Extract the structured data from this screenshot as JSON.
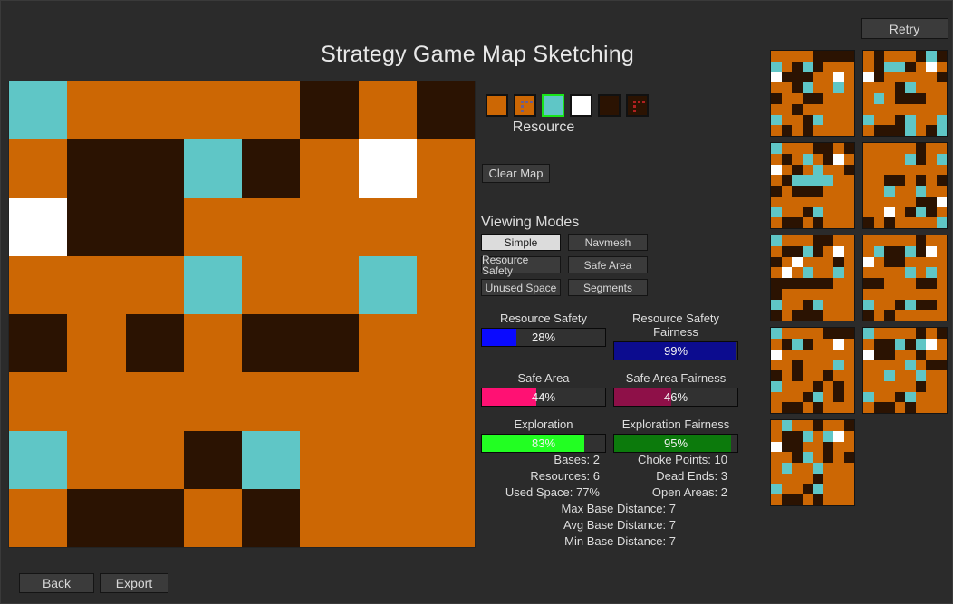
{
  "app": {
    "title": "Strategy Game Map Sketching",
    "background_color": "#2b2b2b"
  },
  "top_bar": {
    "retry_label": "Retry"
  },
  "colors": {
    "ground": "#cc6704",
    "wall": "#2b1302",
    "resource": "#5fc6c6",
    "base": "#ffffff",
    "accent_selected": "#19e519"
  },
  "palette": {
    "label": "Resource",
    "selected_index": 2,
    "swatches": [
      {
        "name": "ground",
        "fill": "#cc6704",
        "mark": null
      },
      {
        "name": "ground-ramp",
        "fill": "#cc6704",
        "mark": "#6a5f8e"
      },
      {
        "name": "resource",
        "fill": "#5fc6c6",
        "mark": null
      },
      {
        "name": "base",
        "fill": "#ffffff",
        "mark": null
      },
      {
        "name": "wall",
        "fill": "#2b1302",
        "mark": null
      },
      {
        "name": "wall-ramp",
        "fill": "#2b1302",
        "mark": "#b02020"
      }
    ]
  },
  "tools": {
    "clear_map_label": "Clear Map"
  },
  "viewing_modes": {
    "title": "Viewing Modes",
    "active": "Simple",
    "items": [
      {
        "label": "Simple",
        "active": true
      },
      {
        "label": "Navmesh",
        "active": false
      },
      {
        "label": "Resource Safety",
        "active": false
      },
      {
        "label": "Safe Area",
        "active": false
      },
      {
        "label": "Unused Space",
        "active": false
      },
      {
        "label": "Segments",
        "active": false
      }
    ]
  },
  "metrics": [
    {
      "label": "Resource Safety",
      "value": 28,
      "text": "28%",
      "fill": "#0a0aff"
    },
    {
      "label": "Resource Safety Fairness",
      "value": 99,
      "text": "99%",
      "fill": "#0c0c8f"
    },
    {
      "label": "Safe Area",
      "value": 44,
      "text": "44%",
      "fill": "#ff1173"
    },
    {
      "label": "Safe Area Fairness",
      "value": 46,
      "text": "46%",
      "fill": "#8e1048"
    },
    {
      "label": "Exploration",
      "value": 83,
      "text": "83%",
      "fill": "#22ff22"
    },
    {
      "label": "Exploration Fairness",
      "value": 95,
      "text": "95%",
      "fill": "#0c7a0c"
    }
  ],
  "stats": {
    "left": [
      "Bases: 2",
      "Resources: 6",
      "Used Space: 77%"
    ],
    "right": [
      "Choke Points: 10",
      "Dead Ends: 3",
      "Open Areas: 2"
    ],
    "center": [
      "Max Base Distance: 7",
      "Avg Base Distance: 7",
      "Min Base Distance: 7"
    ]
  },
  "map": {
    "rows": 8,
    "cols": 8,
    "legend": {
      "g": "#cc6704",
      "w": "#2b1302",
      "r": "#5fc6c6",
      "b": "#ffffff"
    },
    "grid": [
      [
        "r",
        "g",
        "g",
        "g",
        "g",
        "w",
        "g",
        "w"
      ],
      [
        "g",
        "w",
        "w",
        "r",
        "w",
        "g",
        "b",
        "g"
      ],
      [
        "b",
        "w",
        "w",
        "g",
        "g",
        "g",
        "g",
        "g"
      ],
      [
        "g",
        "g",
        "g",
        "r",
        "g",
        "g",
        "r",
        "g"
      ],
      [
        "w",
        "g",
        "w",
        "g",
        "w",
        "w",
        "g",
        "g"
      ],
      [
        "g",
        "g",
        "g",
        "g",
        "g",
        "g",
        "g",
        "g"
      ],
      [
        "r",
        "g",
        "g",
        "w",
        "r",
        "g",
        "g",
        "g"
      ],
      [
        "g",
        "w",
        "w",
        "g",
        "w",
        "g",
        "g",
        "g"
      ]
    ]
  },
  "thumbnails": [
    {
      "name": "variant-1",
      "grid": [
        [
          "g",
          "g",
          "g",
          "g",
          "w",
          "w",
          "w",
          "w"
        ],
        [
          "r",
          "g",
          "w",
          "r",
          "w",
          "g",
          "g",
          "g"
        ],
        [
          "b",
          "w",
          "w",
          "w",
          "g",
          "g",
          "b",
          "g"
        ],
        [
          "g",
          "g",
          "w",
          "r",
          "g",
          "g",
          "r",
          "g"
        ],
        [
          "w",
          "g",
          "g",
          "w",
          "w",
          "g",
          "g",
          "g"
        ],
        [
          "g",
          "g",
          "w",
          "g",
          "g",
          "g",
          "g",
          "g"
        ],
        [
          "r",
          "g",
          "g",
          "w",
          "r",
          "g",
          "g",
          "g"
        ],
        [
          "g",
          "w",
          "g",
          "w",
          "g",
          "g",
          "g",
          "g"
        ]
      ]
    },
    {
      "name": "variant-2",
      "grid": [
        [
          "g",
          "w",
          "g",
          "g",
          "g",
          "w",
          "r",
          "w"
        ],
        [
          "g",
          "w",
          "r",
          "r",
          "w",
          "g",
          "b",
          "g"
        ],
        [
          "b",
          "w",
          "g",
          "g",
          "g",
          "g",
          "g",
          "w"
        ],
        [
          "g",
          "g",
          "g",
          "w",
          "r",
          "g",
          "g",
          "g"
        ],
        [
          "g",
          "r",
          "g",
          "w",
          "w",
          "w",
          "g",
          "g"
        ],
        [
          "g",
          "g",
          "g",
          "g",
          "g",
          "g",
          "g",
          "g"
        ],
        [
          "r",
          "g",
          "g",
          "w",
          "r",
          "g",
          "g",
          "r"
        ],
        [
          "g",
          "w",
          "w",
          "w",
          "r",
          "g",
          "w",
          "r"
        ]
      ]
    },
    {
      "name": "variant-3",
      "grid": [
        [
          "r",
          "g",
          "g",
          "g",
          "w",
          "w",
          "g",
          "w"
        ],
        [
          "g",
          "w",
          "g",
          "r",
          "g",
          "w",
          "b",
          "g"
        ],
        [
          "b",
          "g",
          "w",
          "g",
          "r",
          "g",
          "g",
          "w"
        ],
        [
          "g",
          "w",
          "r",
          "r",
          "r",
          "r",
          "g",
          "g"
        ],
        [
          "w",
          "g",
          "w",
          "w",
          "w",
          "g",
          "g",
          "g"
        ],
        [
          "g",
          "g",
          "g",
          "g",
          "g",
          "g",
          "g",
          "g"
        ],
        [
          "r",
          "g",
          "g",
          "w",
          "r",
          "g",
          "g",
          "g"
        ],
        [
          "g",
          "w",
          "w",
          "g",
          "w",
          "g",
          "g",
          "g"
        ]
      ]
    },
    {
      "name": "variant-4",
      "grid": [
        [
          "g",
          "g",
          "g",
          "g",
          "g",
          "w",
          "g",
          "g"
        ],
        [
          "g",
          "g",
          "g",
          "g",
          "r",
          "w",
          "g",
          "r"
        ],
        [
          "g",
          "g",
          "g",
          "g",
          "g",
          "g",
          "g",
          "g"
        ],
        [
          "g",
          "g",
          "w",
          "w",
          "g",
          "w",
          "g",
          "w"
        ],
        [
          "g",
          "g",
          "r",
          "g",
          "g",
          "r",
          "g",
          "g"
        ],
        [
          "g",
          "g",
          "g",
          "g",
          "g",
          "w",
          "w",
          "b"
        ],
        [
          "g",
          "g",
          "b",
          "g",
          "w",
          "r",
          "w",
          "g"
        ],
        [
          "w",
          "g",
          "w",
          "g",
          "g",
          "g",
          "g",
          "r"
        ]
      ]
    },
    {
      "name": "variant-5",
      "grid": [
        [
          "r",
          "g",
          "g",
          "g",
          "w",
          "w",
          "g",
          "g"
        ],
        [
          "g",
          "w",
          "w",
          "r",
          "w",
          "g",
          "b",
          "g"
        ],
        [
          "w",
          "g",
          "b",
          "g",
          "g",
          "g",
          "w",
          "g"
        ],
        [
          "g",
          "b",
          "g",
          "r",
          "g",
          "g",
          "r",
          "g"
        ],
        [
          "w",
          "w",
          "w",
          "w",
          "w",
          "w",
          "g",
          "g"
        ],
        [
          "w",
          "g",
          "g",
          "g",
          "g",
          "g",
          "g",
          "g"
        ],
        [
          "r",
          "g",
          "g",
          "w",
          "r",
          "g",
          "g",
          "g"
        ],
        [
          "w",
          "g",
          "w",
          "w",
          "w",
          "g",
          "g",
          "g"
        ]
      ]
    },
    {
      "name": "variant-6",
      "grid": [
        [
          "g",
          "g",
          "g",
          "g",
          "g",
          "w",
          "g",
          "g"
        ],
        [
          "g",
          "r",
          "w",
          "w",
          "r",
          "w",
          "b",
          "g"
        ],
        [
          "b",
          "g",
          "w",
          "w",
          "g",
          "g",
          "g",
          "g"
        ],
        [
          "g",
          "g",
          "g",
          "g",
          "r",
          "g",
          "r",
          "g"
        ],
        [
          "w",
          "w",
          "g",
          "g",
          "g",
          "w",
          "w",
          "g"
        ],
        [
          "g",
          "g",
          "g",
          "g",
          "g",
          "g",
          "g",
          "g"
        ],
        [
          "r",
          "g",
          "g",
          "w",
          "r",
          "w",
          "w",
          "g"
        ],
        [
          "w",
          "g",
          "w",
          "g",
          "g",
          "g",
          "g",
          "g"
        ]
      ]
    },
    {
      "name": "variant-7",
      "grid": [
        [
          "r",
          "g",
          "g",
          "g",
          "g",
          "w",
          "w",
          "w"
        ],
        [
          "g",
          "w",
          "r",
          "w",
          "g",
          "g",
          "b",
          "g"
        ],
        [
          "b",
          "g",
          "g",
          "g",
          "g",
          "g",
          "g",
          "g"
        ],
        [
          "g",
          "g",
          "w",
          "g",
          "g",
          "g",
          "r",
          "g"
        ],
        [
          "w",
          "g",
          "w",
          "g",
          "g",
          "w",
          "g",
          "g"
        ],
        [
          "r",
          "g",
          "g",
          "g",
          "w",
          "g",
          "w",
          "g"
        ],
        [
          "g",
          "g",
          "g",
          "w",
          "r",
          "g",
          "w",
          "g"
        ],
        [
          "g",
          "w",
          "w",
          "g",
          "w",
          "g",
          "g",
          "g"
        ]
      ]
    },
    {
      "name": "variant-8",
      "grid": [
        [
          "r",
          "g",
          "g",
          "g",
          "g",
          "w",
          "g",
          "w"
        ],
        [
          "g",
          "w",
          "w",
          "r",
          "w",
          "r",
          "b",
          "g"
        ],
        [
          "b",
          "w",
          "w",
          "g",
          "g",
          "w",
          "g",
          "g"
        ],
        [
          "g",
          "g",
          "g",
          "g",
          "r",
          "g",
          "w",
          "w"
        ],
        [
          "g",
          "g",
          "r",
          "g",
          "g",
          "r",
          "g",
          "g"
        ],
        [
          "g",
          "g",
          "g",
          "g",
          "g",
          "w",
          "g",
          "g"
        ],
        [
          "r",
          "g",
          "g",
          "w",
          "r",
          "g",
          "g",
          "g"
        ],
        [
          "g",
          "w",
          "w",
          "g",
          "w",
          "g",
          "g",
          "g"
        ]
      ]
    },
    {
      "name": "variant-9",
      "grid": [
        [
          "g",
          "r",
          "g",
          "g",
          "w",
          "g",
          "g",
          "w"
        ],
        [
          "g",
          "w",
          "w",
          "r",
          "g",
          "r",
          "b",
          "g"
        ],
        [
          "b",
          "w",
          "w",
          "g",
          "g",
          "w",
          "g",
          "g"
        ],
        [
          "g",
          "g",
          "w",
          "r",
          "g",
          "w",
          "g",
          "w"
        ],
        [
          "g",
          "r",
          "g",
          "g",
          "r",
          "g",
          "g",
          "g"
        ],
        [
          "g",
          "g",
          "g",
          "g",
          "w",
          "g",
          "g",
          "g"
        ],
        [
          "r",
          "g",
          "g",
          "w",
          "r",
          "g",
          "g",
          "g"
        ],
        [
          "g",
          "w",
          "w",
          "g",
          "w",
          "g",
          "g",
          "g"
        ]
      ]
    }
  ],
  "footer": {
    "back_label": "Back",
    "export_label": "Export"
  }
}
